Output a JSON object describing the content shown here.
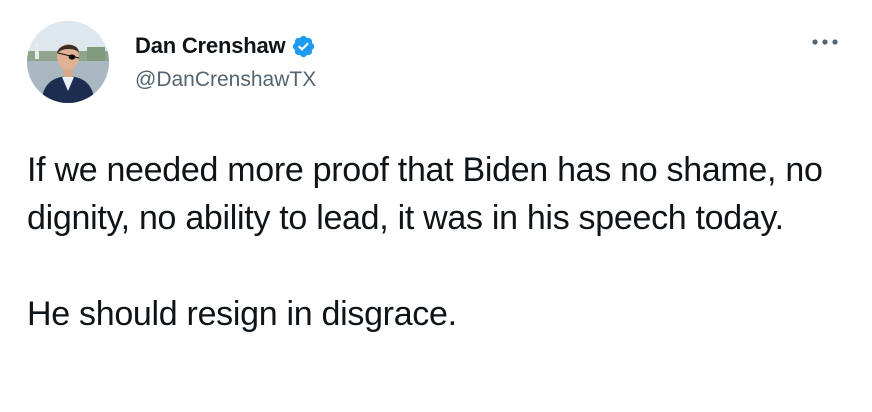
{
  "author": {
    "display_name": "Dan Crenshaw",
    "handle": "@DanCrenshawTX",
    "verified": true,
    "verified_color": "#1d9bf0"
  },
  "tweet": {
    "paragraphs": [
      "If we needed more proof that Biden has no shame, no dignity, no ability to lead, it was in his speech today.",
      "He should resign in disgrace."
    ]
  },
  "icons": {
    "verified": "verified-badge-icon",
    "more": "more-options-icon"
  },
  "colors": {
    "text_primary": "#0f1419",
    "text_secondary": "#536471",
    "background": "#ffffff"
  }
}
